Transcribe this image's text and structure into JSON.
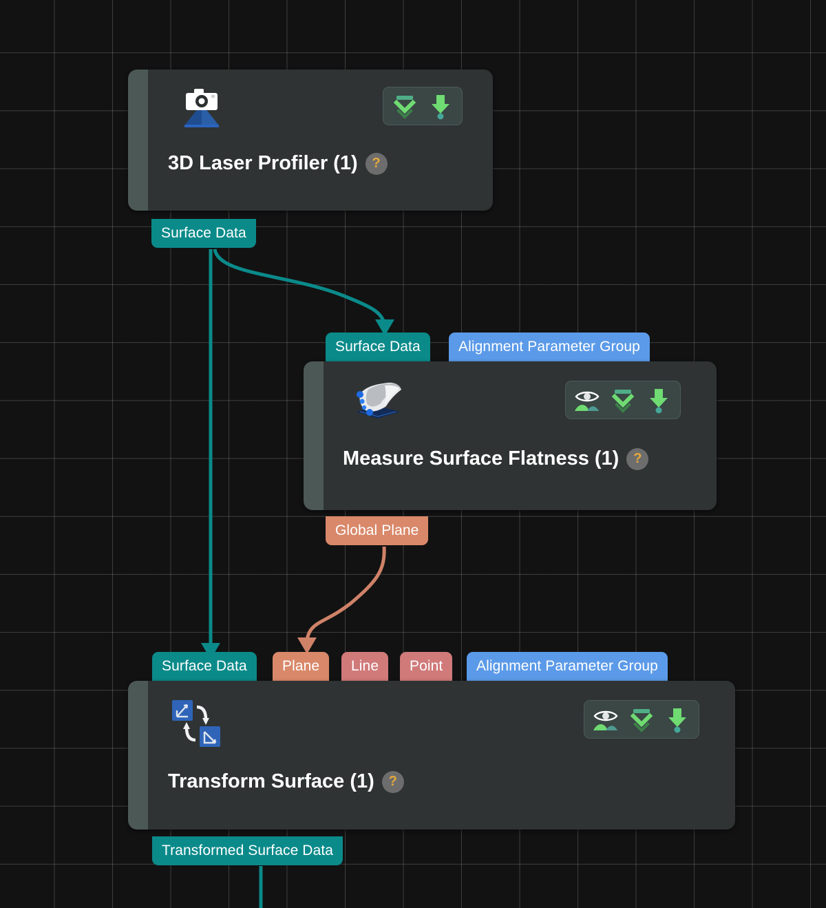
{
  "canvas": {
    "background_color": "#121212",
    "grid_color": "#bebebe"
  },
  "palette": {
    "surface_data": "#0b8a8a",
    "alignment_parameter_group": "#5b9ae8",
    "plane": "#d9886a",
    "line": "#d07a7a",
    "point": "#d07a7a",
    "node_body": "#2f3334",
    "node_accent": "#4c5856",
    "toolbar_icon_green": "#6fdb72",
    "help_badge": "#e5a93c"
  },
  "nodes": [
    {
      "id": "laser-profiler",
      "title": "3D Laser Profiler (1)",
      "help_label": "?",
      "icon": "camera-laser-icon",
      "toolbar": [
        {
          "name": "collapse-chevrons-icon",
          "label": "Collapse"
        },
        {
          "name": "download-arrow-icon",
          "label": "Output"
        }
      ],
      "inputs": [],
      "outputs": [
        {
          "label": "Surface Data",
          "color": "surface_data"
        }
      ]
    },
    {
      "id": "measure-surface-flatness",
      "title": "Measure Surface Flatness (1)",
      "help_label": "?",
      "icon": "surface-flatness-icon",
      "toolbar": [
        {
          "name": "visibility-eye-icon",
          "label": "Visibility"
        },
        {
          "name": "collapse-chevrons-icon",
          "label": "Collapse"
        },
        {
          "name": "download-arrow-icon",
          "label": "Output"
        }
      ],
      "inputs": [
        {
          "label": "Surface Data",
          "color": "surface_data"
        },
        {
          "label": "Alignment Parameter Group",
          "color": "alignment_parameter_group"
        }
      ],
      "outputs": [
        {
          "label": "Global Plane",
          "color": "plane"
        }
      ]
    },
    {
      "id": "transform-surface",
      "title": "Transform Surface (1)",
      "help_label": "?",
      "icon": "transform-axes-icon",
      "toolbar": [
        {
          "name": "visibility-eye-icon",
          "label": "Visibility"
        },
        {
          "name": "collapse-chevrons-icon",
          "label": "Collapse"
        },
        {
          "name": "download-arrow-icon",
          "label": "Output"
        }
      ],
      "inputs": [
        {
          "label": "Surface Data",
          "color": "surface_data"
        },
        {
          "label": "Plane",
          "color": "plane"
        },
        {
          "label": "Line",
          "color": "line"
        },
        {
          "label": "Point",
          "color": "point"
        },
        {
          "label": "Alignment Parameter Group",
          "color": "alignment_parameter_group"
        }
      ],
      "outputs": [
        {
          "label": "Transformed Surface Data",
          "color": "surface_data"
        }
      ]
    }
  ],
  "connections": [
    {
      "from": "3D Laser Profiler (1) / Surface Data",
      "to": "Measure Surface Flatness (1) / Surface Data",
      "color": "#0b8a8a"
    },
    {
      "from": "3D Laser Profiler (1) / Surface Data",
      "to": "Transform Surface (1) / Surface Data",
      "color": "#0b8a8a"
    },
    {
      "from": "Measure Surface Flatness (1) / Global Plane",
      "to": "Transform Surface (1) / Plane",
      "color": "#d9886a"
    },
    {
      "from": "Transform Surface (1) / Transformed Surface Data",
      "to": "(off-screen)",
      "color": "#0b8a8a"
    }
  ]
}
